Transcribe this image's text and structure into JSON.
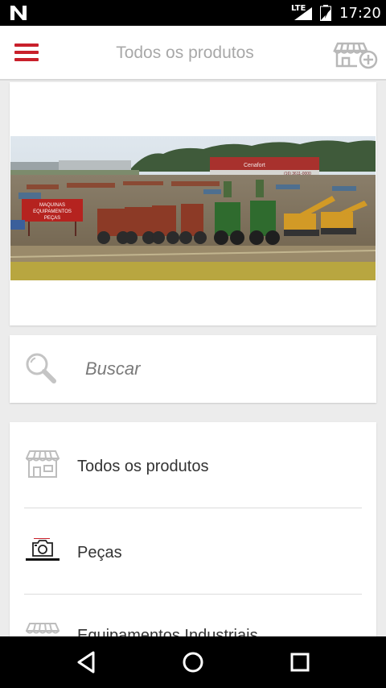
{
  "status_bar": {
    "time": "17:20",
    "network": "LTE",
    "icons": [
      "notification-n-icon",
      "signal-icon",
      "battery-icon"
    ]
  },
  "app_bar": {
    "title": "Todos os produtos",
    "menu_icon": "hamburger-menu-icon",
    "action_icon": "store-add-icon",
    "accent_color": "#c8202b"
  },
  "banner": {
    "sign_lines": [
      "MAQUINAS",
      "EQUIPAMENTOS",
      "PEÇAS"
    ],
    "building_sign_phone": "(16) 3611-0000"
  },
  "search": {
    "placeholder": "Buscar",
    "icon": "search-icon"
  },
  "categories": [
    {
      "label": "Todos os produtos",
      "icon": "store-icon"
    },
    {
      "label": "Peças",
      "icon": "camera-icon"
    },
    {
      "label": "Equipamentos Industriais",
      "icon": "store-icon"
    }
  ],
  "nav_bar": {
    "buttons": [
      "back-icon",
      "home-icon",
      "recents-icon"
    ]
  }
}
